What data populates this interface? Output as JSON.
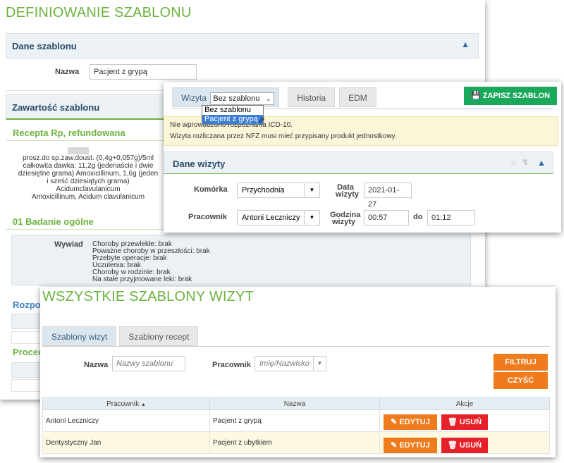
{
  "definiowanie": {
    "title": "DEFINIOWANIE SZABLONU",
    "dane_szablonu": "Dane szablonu",
    "nazwa_label": "Nazwa",
    "nazwa_value": "Pacjent z grypą",
    "zawartosc": "Zawartość szablonu",
    "recepta_title": "Recepta Rp, refundowana",
    "recepta_lines": [
      "prosz.do sp.zaw.doust. (0,4g+0,057g)/5ml",
      "całkowita dawka: 11,2g (jedenaście i dwie",
      "dziesiętne grama) Amoxicillinum, 1,6g (jeden",
      "i sześć dziesiątych grama)",
      "Acidumclavulanicum",
      "Amoxicillinum, Acidum clavulanicum"
    ],
    "badanie_title": "01 Badanie ogólne",
    "wywiad_label": "Wywiad",
    "wywiad_lines": [
      "Choroby przewlekłe: brak",
      "Poważne choroby w przeszłości: brak",
      "Przebyte operacje: brak",
      "Uczulenia: brak",
      "Choroby w rodzinie: brak",
      "Na stałe przyjmowane leki: brak"
    ],
    "rozpoz_partial": "Rozpoz",
    "proced_partial": "Proced"
  },
  "wizyta": {
    "tab_wizyta": "Wizyta",
    "select_value": "Bez szablonu",
    "select_options": [
      "Bez szablonu",
      "Pacjent z grypą"
    ],
    "tab_historia": "Historia",
    "tab_edm": "EDM",
    "save_button": "ZAPISZ SZABLON",
    "warning_line1": "Nie wprowadzono rozpoznania ICD-10.",
    "warning_line2": "Wizyta rozliczana przez NFZ musi mieć przypisany produkt jednostkowy.",
    "dane_wizyty": "Dane wizyty",
    "komorka_label": "Komórka",
    "komorka_value": "Przychodnia",
    "data_label_1": "Data",
    "data_label_2": "wizyty",
    "data_value": "2021-01-27",
    "pracownik_label": "Pracownik",
    "pracownik_value": "Antoni Leczniczy",
    "godzina_label_1": "Godzina",
    "godzina_label_2": "wizyty",
    "godzina_od": "00:57",
    "do_label": "do",
    "godzina_do": "01:12"
  },
  "wszystkie": {
    "title": "WSZYSTKIE SZABLONY WIZYT",
    "tab_wizyt": "Szablony wizyt",
    "tab_recept": "Szablony recept",
    "nazwa_label": "Nazwa",
    "nazwa_placeholder": "Nazwy szablonu",
    "pracownik_label": "Pracownik",
    "pracownik_placeholder": "Imię/Nazwisko",
    "filtruj": "FILTRUJ",
    "czysc": "CZYŚĆ",
    "col_pracownik": "Pracownik",
    "col_nazwa": "Nazwa",
    "col_akcje": "Akcje",
    "rows": [
      {
        "pracownik": "Antoni Leczniczy",
        "nazwa": "Pacjent z grypą"
      },
      {
        "pracownik": "Dentystyczny Jan",
        "nazwa": "Pacjent z ubytkiem"
      }
    ],
    "edytuj": "EDYTUJ",
    "usun": "USUŃ"
  },
  "colors": {
    "green": "#6cb33f",
    "orange": "#f07b1c",
    "red": "#e8202a",
    "save_green": "#1aa85a"
  }
}
